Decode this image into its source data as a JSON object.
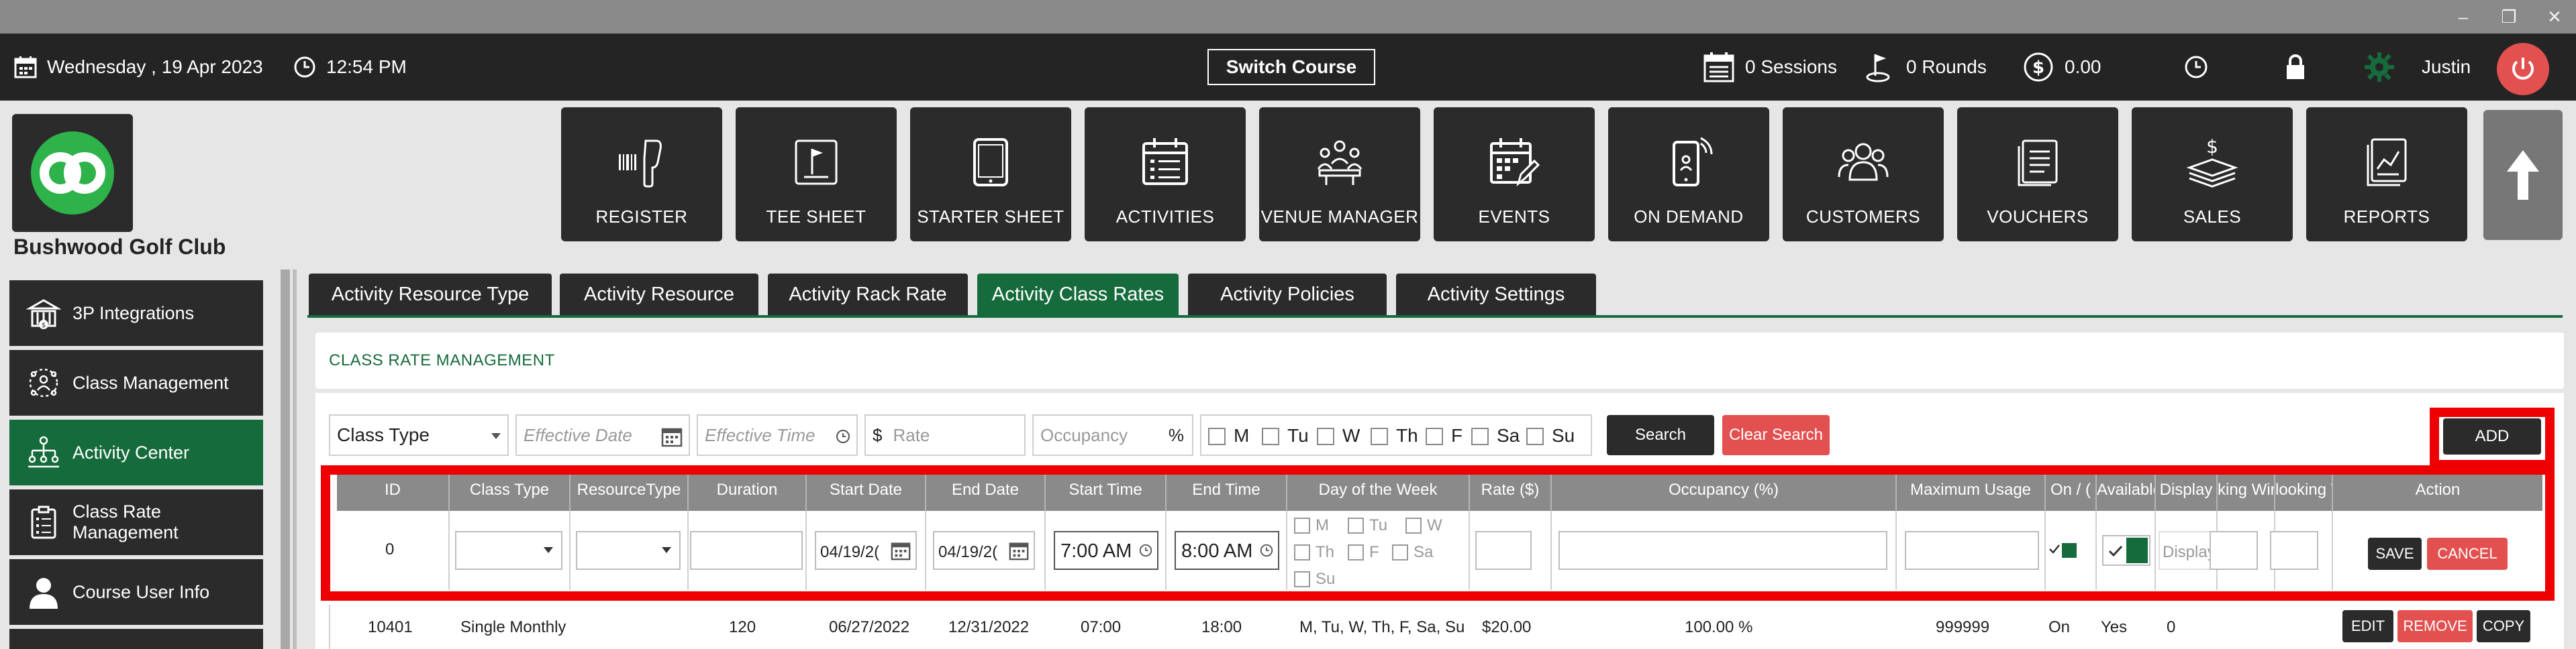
{
  "header": {
    "date": "Wednesday ,  19 Apr 2023",
    "time": "12:54 PM",
    "switch_course": "Switch Course",
    "sessions": "0 Sessions",
    "rounds": "0 Rounds",
    "balance": "0.00",
    "user": "Justin"
  },
  "club": {
    "name": "Bushwood Golf Club"
  },
  "modules": [
    {
      "label": "REGISTER",
      "icon": "register-icon"
    },
    {
      "label": "TEE SHEET",
      "icon": "tee-sheet-icon"
    },
    {
      "label": "STARTER SHEET",
      "icon": "tablet-icon"
    },
    {
      "label": "ACTIVITIES",
      "icon": "calendar-list-icon"
    },
    {
      "label": "VENUE MANAGER",
      "icon": "venue-icon"
    },
    {
      "label": "EVENTS",
      "icon": "events-calendar-icon"
    },
    {
      "label": "ON DEMAND",
      "icon": "phone-signal-icon"
    },
    {
      "label": "CUSTOMERS",
      "icon": "customers-icon"
    },
    {
      "label": "VOUCHERS",
      "icon": "vouchers-icon"
    },
    {
      "label": "SALES",
      "icon": "sales-icon"
    },
    {
      "label": "REPORTS",
      "icon": "reports-icon"
    }
  ],
  "sidebar": {
    "items": [
      {
        "label": "3P Integrations"
      },
      {
        "label": "Class Management"
      },
      {
        "label": "Activity  Center"
      },
      {
        "label": "Class Rate Management"
      },
      {
        "label": "Course User Info"
      }
    ]
  },
  "tabs": [
    {
      "label": "Activity Resource Type"
    },
    {
      "label": "Activity Resource"
    },
    {
      "label": "Activity Rack Rate"
    },
    {
      "label": "Activity Class Rates"
    },
    {
      "label": "Activity Policies"
    },
    {
      "label": "Activity Settings"
    }
  ],
  "section_title": "CLASS RATE MANAGEMENT",
  "filters": {
    "class_type": "Class Type",
    "effective_date_placeholder": "Effective Date",
    "effective_time_placeholder": "Effective Time",
    "rate_prefix": "$",
    "rate_placeholder": "Rate",
    "occupancy_placeholder": "Occupancy",
    "occupancy_suffix": "%",
    "days": [
      "M",
      "Tu",
      "W",
      "Th",
      "F",
      "Sa",
      "Su"
    ],
    "search": "Search",
    "clear_search": "Clear Search",
    "add": "ADD"
  },
  "table": {
    "columns": [
      "ID",
      "Class Type",
      "ResourceType",
      "Duration",
      "Start Date",
      "End Date",
      "Start Time",
      "End Time",
      "Day of the Week",
      "Rate ($)",
      "Occupancy (%)",
      "Maximum Usage",
      "On / (",
      "Available",
      "Display",
      "king Win",
      "looking W",
      "Action"
    ],
    "new_row": {
      "id": "0",
      "start_date": "04/19/2(",
      "end_date": "04/19/2(",
      "start_time": "7:00 AM",
      "end_time": "8:00 AM",
      "days": [
        "M",
        "Tu",
        "W",
        "Th",
        "F",
        "Sa",
        "Su"
      ],
      "display_placeholder": "Display",
      "save": "SAVE",
      "cancel": "CANCEL"
    },
    "rows": [
      {
        "id": "10401",
        "class_type": "Single Monthly",
        "resource_type": "",
        "duration": "120",
        "start_date": "06/27/2022",
        "end_date": "12/31/2022",
        "start_time": "07:00",
        "end_time": "18:00",
        "days": "M, Tu, W, Th, F, Sa, Su",
        "rate": "$20.00",
        "occupancy": "100.00 %",
        "maximum_usage": "999999",
        "on_off": "On",
        "available": "Yes",
        "display": "0",
        "edit": "EDIT",
        "remove": "REMOVE",
        "copy": "COPY"
      }
    ]
  },
  "colors": {
    "brand_green": "#166b3c",
    "dark": "#2b2b2b",
    "alert_red": "#e2504f",
    "highlight": "#ee0000"
  }
}
